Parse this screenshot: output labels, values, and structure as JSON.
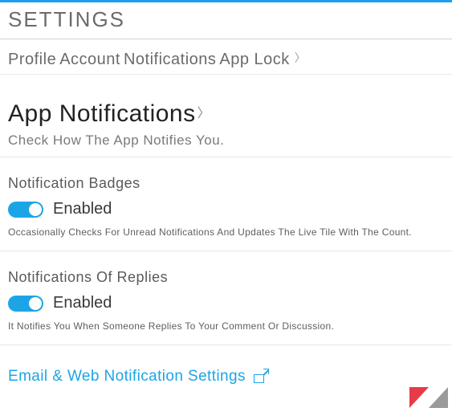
{
  "header": {
    "title": "SETTINGS"
  },
  "tabs": {
    "items": [
      "Profile",
      "Account",
      "Notifications",
      "App Lock"
    ]
  },
  "hero": {
    "title": "App Notifications",
    "subtitle": "Check How The App Notifies You."
  },
  "sections": {
    "badges": {
      "title": "Notification Badges",
      "state_label": "Enabled",
      "enabled": true,
      "description": "Occasionally Checks For Unread Notifications And Updates The Live Tile With The Count."
    },
    "replies": {
      "title": "Notifications Of Replies",
      "state_label": "Enabled",
      "enabled": true,
      "description": "It Notifies You When Someone Replies To Your Comment Or Discussion."
    }
  },
  "link": {
    "label": "Email & Web Notification Settings"
  },
  "colors": {
    "accent": "#1ba5e6",
    "topbar": "#1a9ff1",
    "brand_red": "#e73b47",
    "brand_gray": "#9a9a9a"
  }
}
